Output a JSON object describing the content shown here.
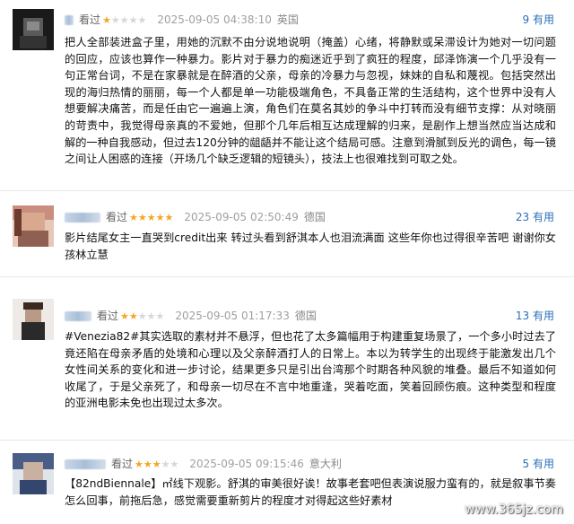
{
  "reviews": [
    {
      "status": "看过",
      "rating": 1,
      "time": "2025-09-05 04:38:10",
      "location": "英国",
      "useful_count": "9",
      "useful_label": "有用",
      "text": "把人全部装进盒子里，用她的沉默不由分说地说明（掩盖）心绪，将静默或呆滞设计为她对一切问题的回应，应该也算作一种暴力。影片对于暴力的痴迷近乎到了疯狂的程度，邱泽饰演一个几乎没有一句正常台词，不是在家暴就是在醉酒的父亲，母亲的冷暴力与忽视，妹妹的自私和蔑视。包括突然出现的海归热情的丽丽，每一个人都是单一功能极端角色，不具备正常的生活结构，这个世界中没有人想要解决痛苦，而是任由它一遍遍上演，角色们在莫名其妙的争斗中打转而没有细节支撑：从对晓丽的苛责中，我觉得母亲真的不爱她，但那个几年后相互达成理解的归来，是剧作上想当然应当达成和解的一种自我感动，但过去120分钟的龃龉并不能让这个结局可感。注意到滑腻到反光的调色，每一镜之间让人困惑的连接（开场几个缺乏逻辑的短镜头），技法上也很难找到可取之处。"
    },
    {
      "status": "看过",
      "rating": 5,
      "time": "2025-09-05 02:50:49",
      "location": "德国",
      "useful_count": "23",
      "useful_label": "有用",
      "text": "影片结尾女主一直哭到credit出来 转过头看到舒淇本人也泪流满面 这些年你也过得很辛苦吧 谢谢你女孩林立慧"
    },
    {
      "status": "看过",
      "rating": 2,
      "time": "2025-09-05 01:17:33",
      "location": "德国",
      "useful_count": "13",
      "useful_label": "有用",
      "text": "#Venezia82#其实选取的素材并不悬浮，但也花了太多篇幅用于构建重复场景了，一个多小时过去了竟还陷在母亲矛盾的处境和心理以及父亲醉酒打人的日常上。本以为转学生的出现终于能激发出几个女性间关系的变化和进一步讨论，结果更多只是引出台湾那个时期各种风貌的堆叠。最后不知道如何收尾了，于是父亲死了，和母亲一切尽在不言中地重逢，哭着吃面，笑着回顾伤痕。这种类型和程度的亚洲电影未免也出现过太多次。"
    },
    {
      "status": "看过",
      "rating": 3,
      "time": "2025-09-05 09:15:46",
      "location": "意大利",
      "useful_count": "5",
      "useful_label": "有用",
      "text": "【82ndBiennale】㎡线下观影。舒淇的审美很好诶！故事老套吧但表演说服力蛮有的，就是叙事节奏怎么回事，前拖后急，感觉需要重新剪片的程度才对得起这些好素材"
    }
  ],
  "watermark": "www.365jz.com",
  "colors": {
    "star_on": "#f5a623",
    "star_off": "#d6d6d6",
    "useful": "#2a6fb8"
  }
}
